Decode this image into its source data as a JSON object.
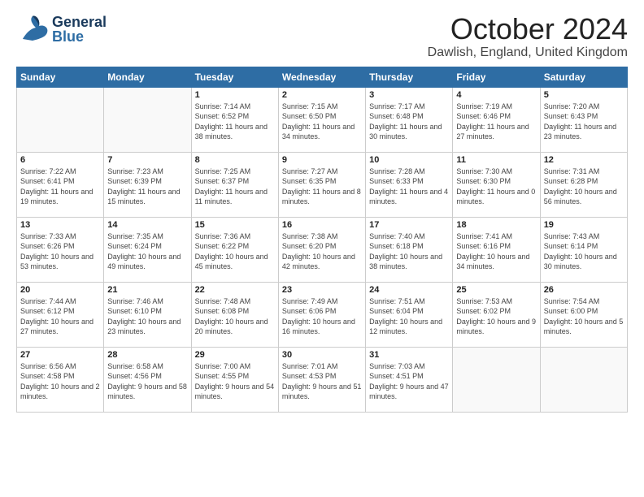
{
  "header": {
    "logo_general": "General",
    "logo_blue": "Blue",
    "month": "October 2024",
    "location": "Dawlish, England, United Kingdom"
  },
  "days_of_week": [
    "Sunday",
    "Monday",
    "Tuesday",
    "Wednesday",
    "Thursday",
    "Friday",
    "Saturday"
  ],
  "weeks": [
    [
      {
        "day": "",
        "info": ""
      },
      {
        "day": "",
        "info": ""
      },
      {
        "day": "1",
        "info": "Sunrise: 7:14 AM\nSunset: 6:52 PM\nDaylight: 11 hours and 38 minutes."
      },
      {
        "day": "2",
        "info": "Sunrise: 7:15 AM\nSunset: 6:50 PM\nDaylight: 11 hours and 34 minutes."
      },
      {
        "day": "3",
        "info": "Sunrise: 7:17 AM\nSunset: 6:48 PM\nDaylight: 11 hours and 30 minutes."
      },
      {
        "day": "4",
        "info": "Sunrise: 7:19 AM\nSunset: 6:46 PM\nDaylight: 11 hours and 27 minutes."
      },
      {
        "day": "5",
        "info": "Sunrise: 7:20 AM\nSunset: 6:43 PM\nDaylight: 11 hours and 23 minutes."
      }
    ],
    [
      {
        "day": "6",
        "info": "Sunrise: 7:22 AM\nSunset: 6:41 PM\nDaylight: 11 hours and 19 minutes."
      },
      {
        "day": "7",
        "info": "Sunrise: 7:23 AM\nSunset: 6:39 PM\nDaylight: 11 hours and 15 minutes."
      },
      {
        "day": "8",
        "info": "Sunrise: 7:25 AM\nSunset: 6:37 PM\nDaylight: 11 hours and 11 minutes."
      },
      {
        "day": "9",
        "info": "Sunrise: 7:27 AM\nSunset: 6:35 PM\nDaylight: 11 hours and 8 minutes."
      },
      {
        "day": "10",
        "info": "Sunrise: 7:28 AM\nSunset: 6:33 PM\nDaylight: 11 hours and 4 minutes."
      },
      {
        "day": "11",
        "info": "Sunrise: 7:30 AM\nSunset: 6:30 PM\nDaylight: 11 hours and 0 minutes."
      },
      {
        "day": "12",
        "info": "Sunrise: 7:31 AM\nSunset: 6:28 PM\nDaylight: 10 hours and 56 minutes."
      }
    ],
    [
      {
        "day": "13",
        "info": "Sunrise: 7:33 AM\nSunset: 6:26 PM\nDaylight: 10 hours and 53 minutes."
      },
      {
        "day": "14",
        "info": "Sunrise: 7:35 AM\nSunset: 6:24 PM\nDaylight: 10 hours and 49 minutes."
      },
      {
        "day": "15",
        "info": "Sunrise: 7:36 AM\nSunset: 6:22 PM\nDaylight: 10 hours and 45 minutes."
      },
      {
        "day": "16",
        "info": "Sunrise: 7:38 AM\nSunset: 6:20 PM\nDaylight: 10 hours and 42 minutes."
      },
      {
        "day": "17",
        "info": "Sunrise: 7:40 AM\nSunset: 6:18 PM\nDaylight: 10 hours and 38 minutes."
      },
      {
        "day": "18",
        "info": "Sunrise: 7:41 AM\nSunset: 6:16 PM\nDaylight: 10 hours and 34 minutes."
      },
      {
        "day": "19",
        "info": "Sunrise: 7:43 AM\nSunset: 6:14 PM\nDaylight: 10 hours and 30 minutes."
      }
    ],
    [
      {
        "day": "20",
        "info": "Sunrise: 7:44 AM\nSunset: 6:12 PM\nDaylight: 10 hours and 27 minutes."
      },
      {
        "day": "21",
        "info": "Sunrise: 7:46 AM\nSunset: 6:10 PM\nDaylight: 10 hours and 23 minutes."
      },
      {
        "day": "22",
        "info": "Sunrise: 7:48 AM\nSunset: 6:08 PM\nDaylight: 10 hours and 20 minutes."
      },
      {
        "day": "23",
        "info": "Sunrise: 7:49 AM\nSunset: 6:06 PM\nDaylight: 10 hours and 16 minutes."
      },
      {
        "day": "24",
        "info": "Sunrise: 7:51 AM\nSunset: 6:04 PM\nDaylight: 10 hours and 12 minutes."
      },
      {
        "day": "25",
        "info": "Sunrise: 7:53 AM\nSunset: 6:02 PM\nDaylight: 10 hours and 9 minutes."
      },
      {
        "day": "26",
        "info": "Sunrise: 7:54 AM\nSunset: 6:00 PM\nDaylight: 10 hours and 5 minutes."
      }
    ],
    [
      {
        "day": "27",
        "info": "Sunrise: 6:56 AM\nSunset: 4:58 PM\nDaylight: 10 hours and 2 minutes."
      },
      {
        "day": "28",
        "info": "Sunrise: 6:58 AM\nSunset: 4:56 PM\nDaylight: 9 hours and 58 minutes."
      },
      {
        "day": "29",
        "info": "Sunrise: 7:00 AM\nSunset: 4:55 PM\nDaylight: 9 hours and 54 minutes."
      },
      {
        "day": "30",
        "info": "Sunrise: 7:01 AM\nSunset: 4:53 PM\nDaylight: 9 hours and 51 minutes."
      },
      {
        "day": "31",
        "info": "Sunrise: 7:03 AM\nSunset: 4:51 PM\nDaylight: 9 hours and 47 minutes."
      },
      {
        "day": "",
        "info": ""
      },
      {
        "day": "",
        "info": ""
      }
    ]
  ]
}
